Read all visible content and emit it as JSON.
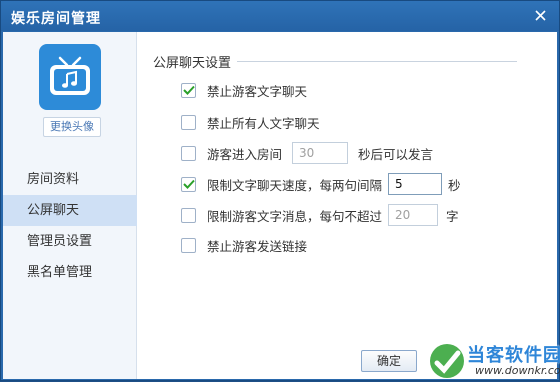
{
  "window": {
    "title": "娱乐房间管理"
  },
  "sidebar": {
    "change_avatar_label": "更换头像",
    "items": [
      {
        "label": "房间资料",
        "active": false
      },
      {
        "label": "公屏聊天",
        "active": true
      },
      {
        "label": "管理员设置",
        "active": false
      },
      {
        "label": "黑名单管理",
        "active": false
      }
    ]
  },
  "panel": {
    "section_title": "公屏聊天设置",
    "options": [
      {
        "label": "禁止游客文字聊天",
        "checked": true
      },
      {
        "label": "禁止所有人文字聊天",
        "checked": false
      },
      {
        "label_before": "游客进入房间",
        "value": "30",
        "label_after": "秒后可以发言",
        "checked": false
      },
      {
        "label_before": "限制文字聊天速度，每两句间隔",
        "value": "5",
        "label_after": "秒",
        "checked": true
      },
      {
        "label_before": "限制游客文字消息，每句不超过",
        "value": "20",
        "label_after": "字",
        "checked": false
      },
      {
        "label": "禁止游客发送链接",
        "checked": false
      }
    ]
  },
  "footer": {
    "ok_label": "确定"
  },
  "watermark": {
    "text": "当客软件园",
    "url": "www.downkr.com"
  },
  "colors": {
    "titlebar": "#2a69ac",
    "accent": "#2d8bd8",
    "check": "#2aa02a",
    "active_nav": "#cfe0f5"
  },
  "icons": {
    "avatar": "tv-music-icon",
    "close": "close-icon",
    "check": "check-icon"
  }
}
